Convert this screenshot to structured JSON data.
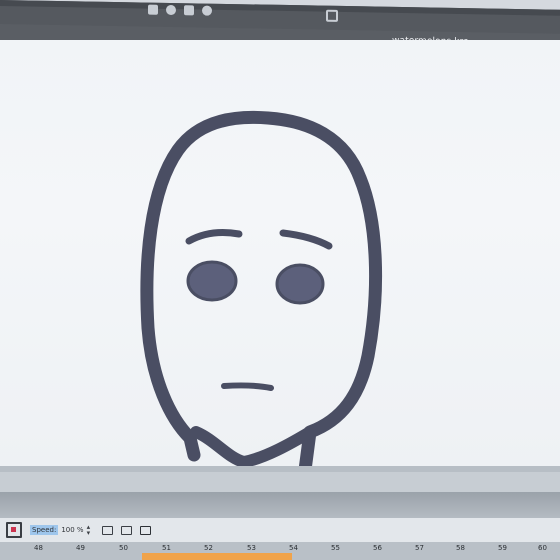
{
  "window": {
    "document_title": "watermelons.kra"
  },
  "animation": {
    "speed_label": "Speed:",
    "speed_value": "100 %",
    "frames": [
      "48",
      "49",
      "50",
      "51",
      "52",
      "53",
      "54",
      "55",
      "56",
      "57",
      "58",
      "59",
      "60"
    ]
  },
  "colors": {
    "stroke": "#4a4e63",
    "eye_fill": "#5c607b",
    "canvas": "#f3f5f8",
    "highlight_frames": "#f0a34a"
  }
}
